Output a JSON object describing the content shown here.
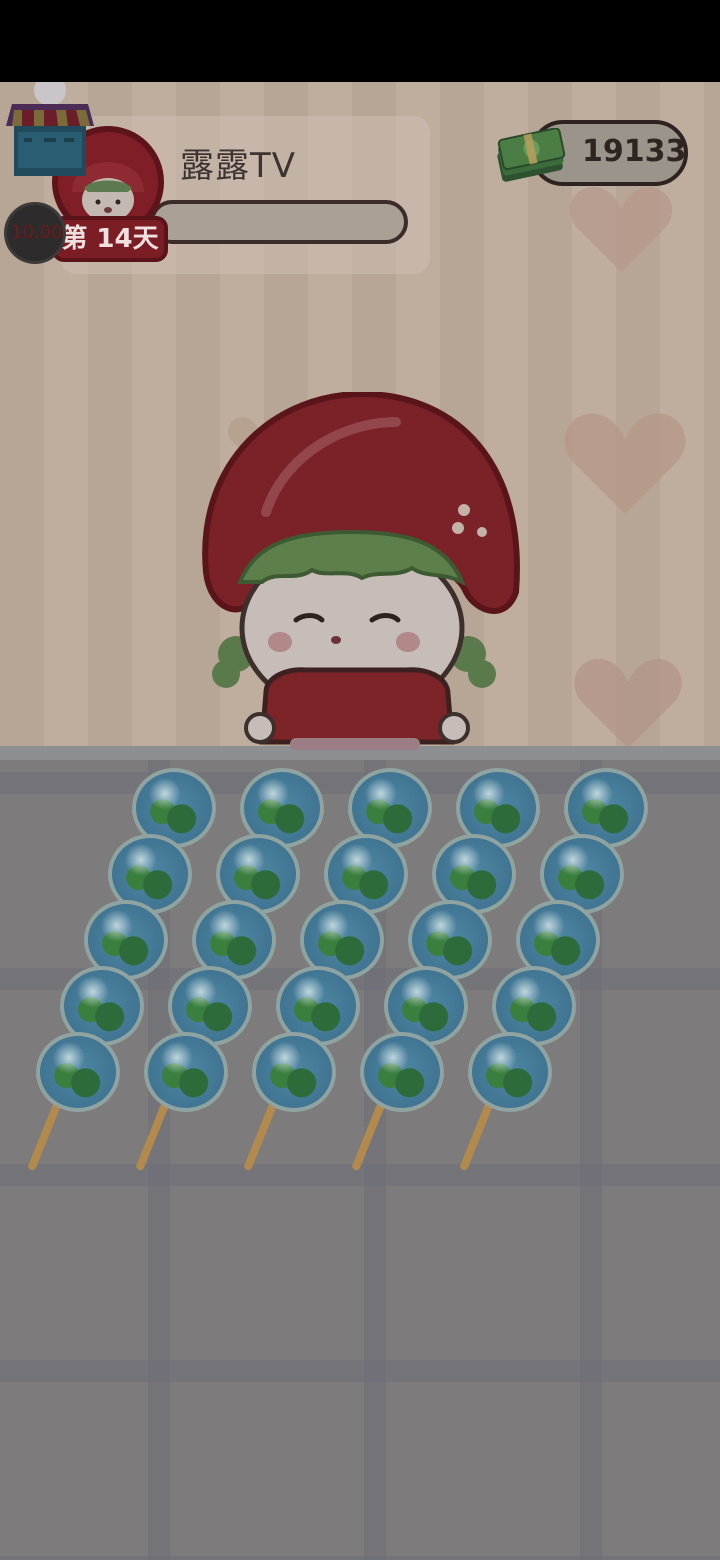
{
  "profile": {
    "player_name": "露露TV",
    "day_label": "第 14天",
    "timer_text": "10.00"
  },
  "currency": {
    "cash_value": "19133",
    "cash_icon": "cash-stack-icon"
  },
  "level_progress": 0.0,
  "skewers": {
    "count": 5,
    "candies_per_skewer": 5,
    "candy_type": "earth-glass-candy"
  },
  "colors": {
    "accent_red": "#7a1d24",
    "money_green": "#3c6b3c"
  }
}
